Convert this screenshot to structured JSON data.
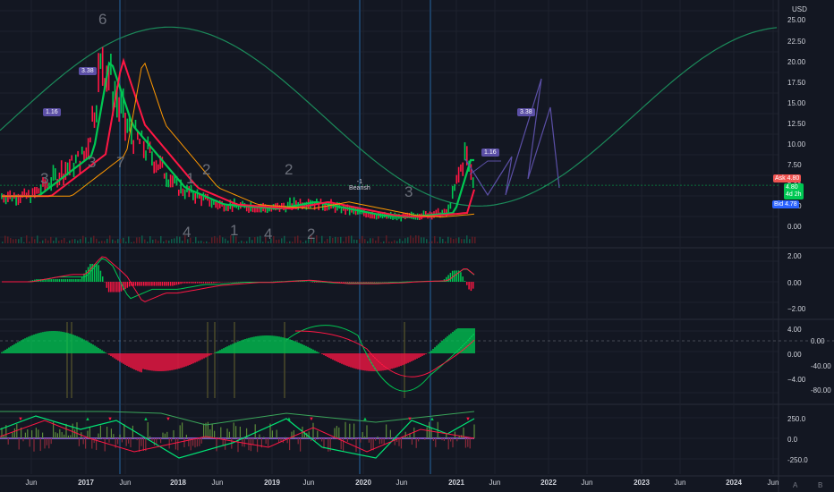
{
  "currency": "USD",
  "price_axis": [
    "25.00",
    "22.50",
    "20.00",
    "17.50",
    "15.00",
    "12.50",
    "10.00",
    "7.50",
    "5.00",
    "2.50",
    "0.00"
  ],
  "price_tags": {
    "ask_label": "Ask",
    "ask_value": "4.80",
    "last": "4.80",
    "last_time": "4d 2h",
    "bid_label": "Bid",
    "bid_value": "4.78"
  },
  "macd_axis": [
    "2.00",
    "0.00",
    "−2.00"
  ],
  "osc_axis": [
    "4.00",
    "0.00",
    "−4.00"
  ],
  "osc_axis_right": [
    "0.00",
    "-40.00",
    "-80.00"
  ],
  "bottom_axis": [
    "250.0",
    "0.0",
    "-250.0"
  ],
  "time_axis": [
    "Jun",
    "2017",
    "Jun",
    "2018",
    "Jun",
    "2019",
    "Jun",
    "2020",
    "Jun",
    "2021",
    "Jun",
    "2022",
    "Jun",
    "2023",
    "Jun",
    "2024",
    "Jun"
  ],
  "wave_labels": [
    "1.16",
    "3.38",
    "1.16",
    "3.38"
  ],
  "wave_counts": [
    "6",
    "3",
    "3",
    "7",
    "1",
    "2",
    "4",
    "1",
    "4",
    "2",
    "2",
    "3"
  ],
  "annotation": {
    "marker": "-1",
    "text": "Bearish"
  },
  "corner_icons": [
    "A",
    "B"
  ],
  "chart_data": {
    "type": "line",
    "x": [
      "2016-06",
      "2016-12",
      "2017-03",
      "2017-06",
      "2017-12",
      "2018-06",
      "2018-12",
      "2019-06",
      "2019-12",
      "2020-03",
      "2020-06",
      "2020-12",
      "2021-02",
      "2021-03"
    ],
    "series": [
      {
        "name": "",
        "values": [
          3.5,
          8.5,
          20.0,
          12.0,
          4.5,
          2.5,
          2.0,
          2.8,
          1.5,
          1.2,
          1.0,
          1.5,
          8.5,
          5.0
        ]
      }
    ],
    "ylim": [
      0,
      25
    ]
  },
  "colors": {
    "up": "#26a69a",
    "down": "#ef5350",
    "green": "#00c853",
    "red": "#ff1744",
    "purple": "#5b4fa6",
    "bg": "#131722"
  }
}
